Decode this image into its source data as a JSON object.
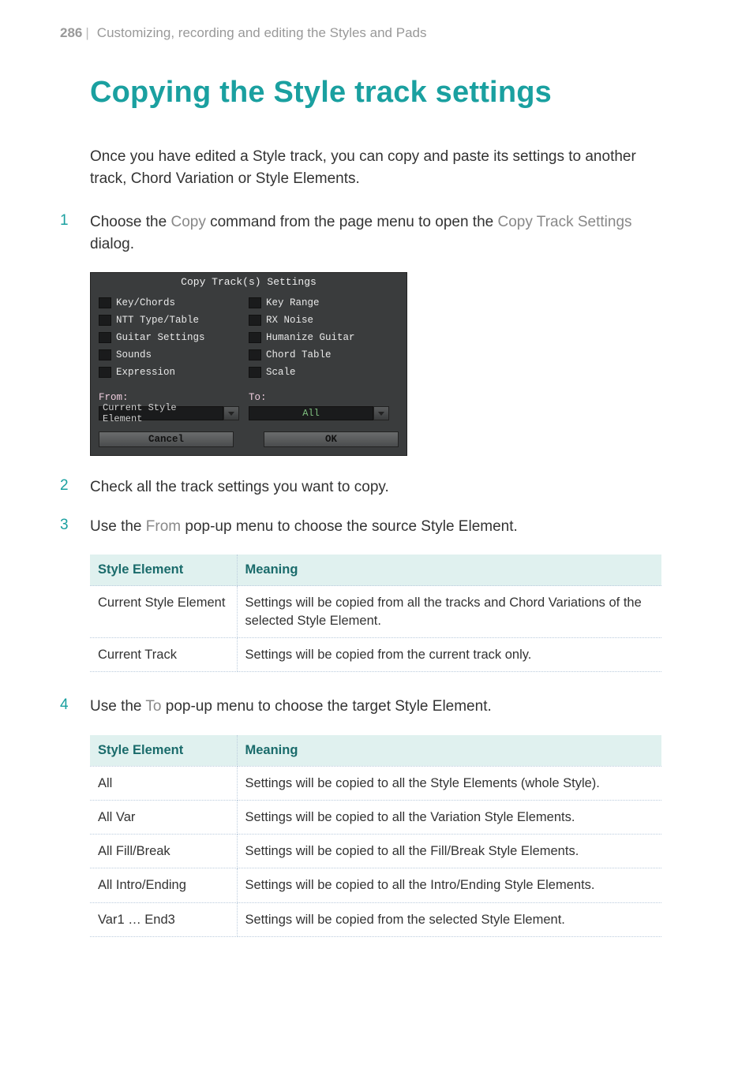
{
  "header": {
    "page_number": "286",
    "section": "Customizing, recording and editing the Styles and Pads"
  },
  "title": "Copying the Style track settings",
  "intro": "Once you have edited a Style track, you can copy and paste its settings to another track, Chord Variation or Style Elements.",
  "steps": {
    "s1": {
      "num": "1",
      "pre": "Choose the ",
      "kw1": "Copy",
      "mid": " command from the page menu to open the ",
      "kw2": "Copy Track Settings",
      "post": " dialog."
    },
    "s2": {
      "num": "2",
      "text": "Check all the track settings you want to copy."
    },
    "s3": {
      "num": "3",
      "pre": "Use the ",
      "kw": "From",
      "post": " pop-up menu to choose the source Style Element."
    },
    "s4": {
      "num": "4",
      "pre": "Use the ",
      "kw": "To",
      "post": " pop-up menu to choose the target Style Element."
    }
  },
  "dialog": {
    "title": "Copy Track(s) Settings",
    "left": [
      "Key/Chords",
      "NTT Type/Table",
      "Guitar Settings",
      "Sounds",
      "Expression"
    ],
    "right": [
      "Key Range",
      "RX Noise",
      "Humanize Guitar",
      "Chord Table",
      "Scale"
    ],
    "from_label": "From:",
    "to_label": "To:",
    "from_value": "Current Style Element",
    "to_value": "All",
    "cancel": "Cancel",
    "ok": "OK"
  },
  "table1": {
    "h1": "Style Element",
    "h2": "Meaning",
    "rows": [
      {
        "c1": "Current Style Element",
        "c2": "Settings will be copied from all the tracks and Chord Variations of the selected Style Element."
      },
      {
        "c1": "Current Track",
        "c2": "Settings will be copied from the current track only."
      }
    ]
  },
  "table2": {
    "h1": "Style Element",
    "h2": "Meaning",
    "rows": [
      {
        "c1": "All",
        "c2": "Settings will be copied to all the Style Elements (whole Style)."
      },
      {
        "c1": "All Var",
        "c2": "Settings will be copied to all the Variation Style Elements."
      },
      {
        "c1": "All Fill/Break",
        "c2": "Settings will be copied to all the Fill/Break Style Elements."
      },
      {
        "c1": "All Intro/Ending",
        "c2": "Settings will be copied to all the Intro/Ending Style Elements."
      },
      {
        "c1": "Var1 … End3",
        "c2": "Settings will be copied from the selected Style Element."
      }
    ]
  }
}
